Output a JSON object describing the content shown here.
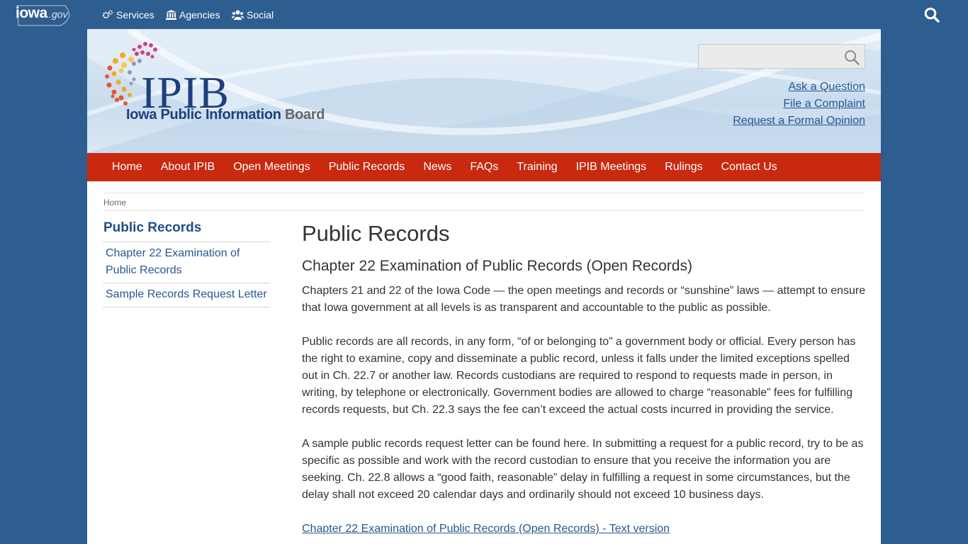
{
  "topbar": {
    "logo_text_main": "iowa",
    "logo_text_suffix": ".gov",
    "links": [
      {
        "label": "Services",
        "icon": "gears-icon"
      },
      {
        "label": "Agencies",
        "icon": "building-icon"
      },
      {
        "label": "Social",
        "icon": "users-icon"
      }
    ],
    "search_icon": "search-icon"
  },
  "banner": {
    "logo_acronym": "IPIB",
    "logo_name_part1": "Iowa ",
    "logo_name_part2": "Public Information",
    "logo_name_part3": " Board",
    "search_placeholder": "",
    "quick_links": [
      "Ask a Question",
      "File a Complaint",
      "Request a Formal Opinion"
    ]
  },
  "nav": {
    "items": [
      "Home",
      "About IPIB",
      "Open Meetings",
      "Public Records",
      "News",
      "FAQs",
      "Training",
      "IPIB Meetings",
      "Rulings",
      "Contact Us"
    ]
  },
  "breadcrumb": {
    "home": "Home"
  },
  "sidebar": {
    "title": "Public Records",
    "items": [
      "Chapter 22 Examination of Public Records",
      "Sample Records Request Letter"
    ]
  },
  "main": {
    "title": "Public Records",
    "subtitle": "Chapter 22 Examination of Public Records (Open Records)",
    "paragraphs": [
      "Chapters 21 and 22 of the Iowa Code — the open meetings and records or “sunshine” laws — attempt to ensure that Iowa government at all levels is as transparent and accountable to the public as possible.",
      "Public records are all records, in any form, “of or belonging to” a government body or official. Every person has the right to examine, copy and disseminate a public record, unless it falls under the limited exceptions spelled out in Ch. 22.7 or another law. Records custodians are required to respond to requests made in person, in writing, by telephone or electronically. Government bodies are allowed to charge “reasonable” fees for fulfilling records requests, but Ch. 22.3 says the fee can’t exceed the actual costs incurred in providing the service.",
      "A sample public records request letter can be found here. In submitting a request for a public record, try to be as specific as possible and work with the record custodian to ensure that you receive the information you are seeking. Ch. 22.8 allows a “good faith, reasonable” delay in fulfilling a request in some circumstances, but the delay shall not exceed 20 calendar days and ordinarily should not exceed 10 business days."
    ],
    "text_version_link": "Chapter 22 Examination of Public Records (Open Records) - Text version"
  },
  "colors": {
    "page_background": "#2e5d8f",
    "nav_background": "#c8290f",
    "link": "#2a5790",
    "logo_blue": "#1f3f7c"
  }
}
